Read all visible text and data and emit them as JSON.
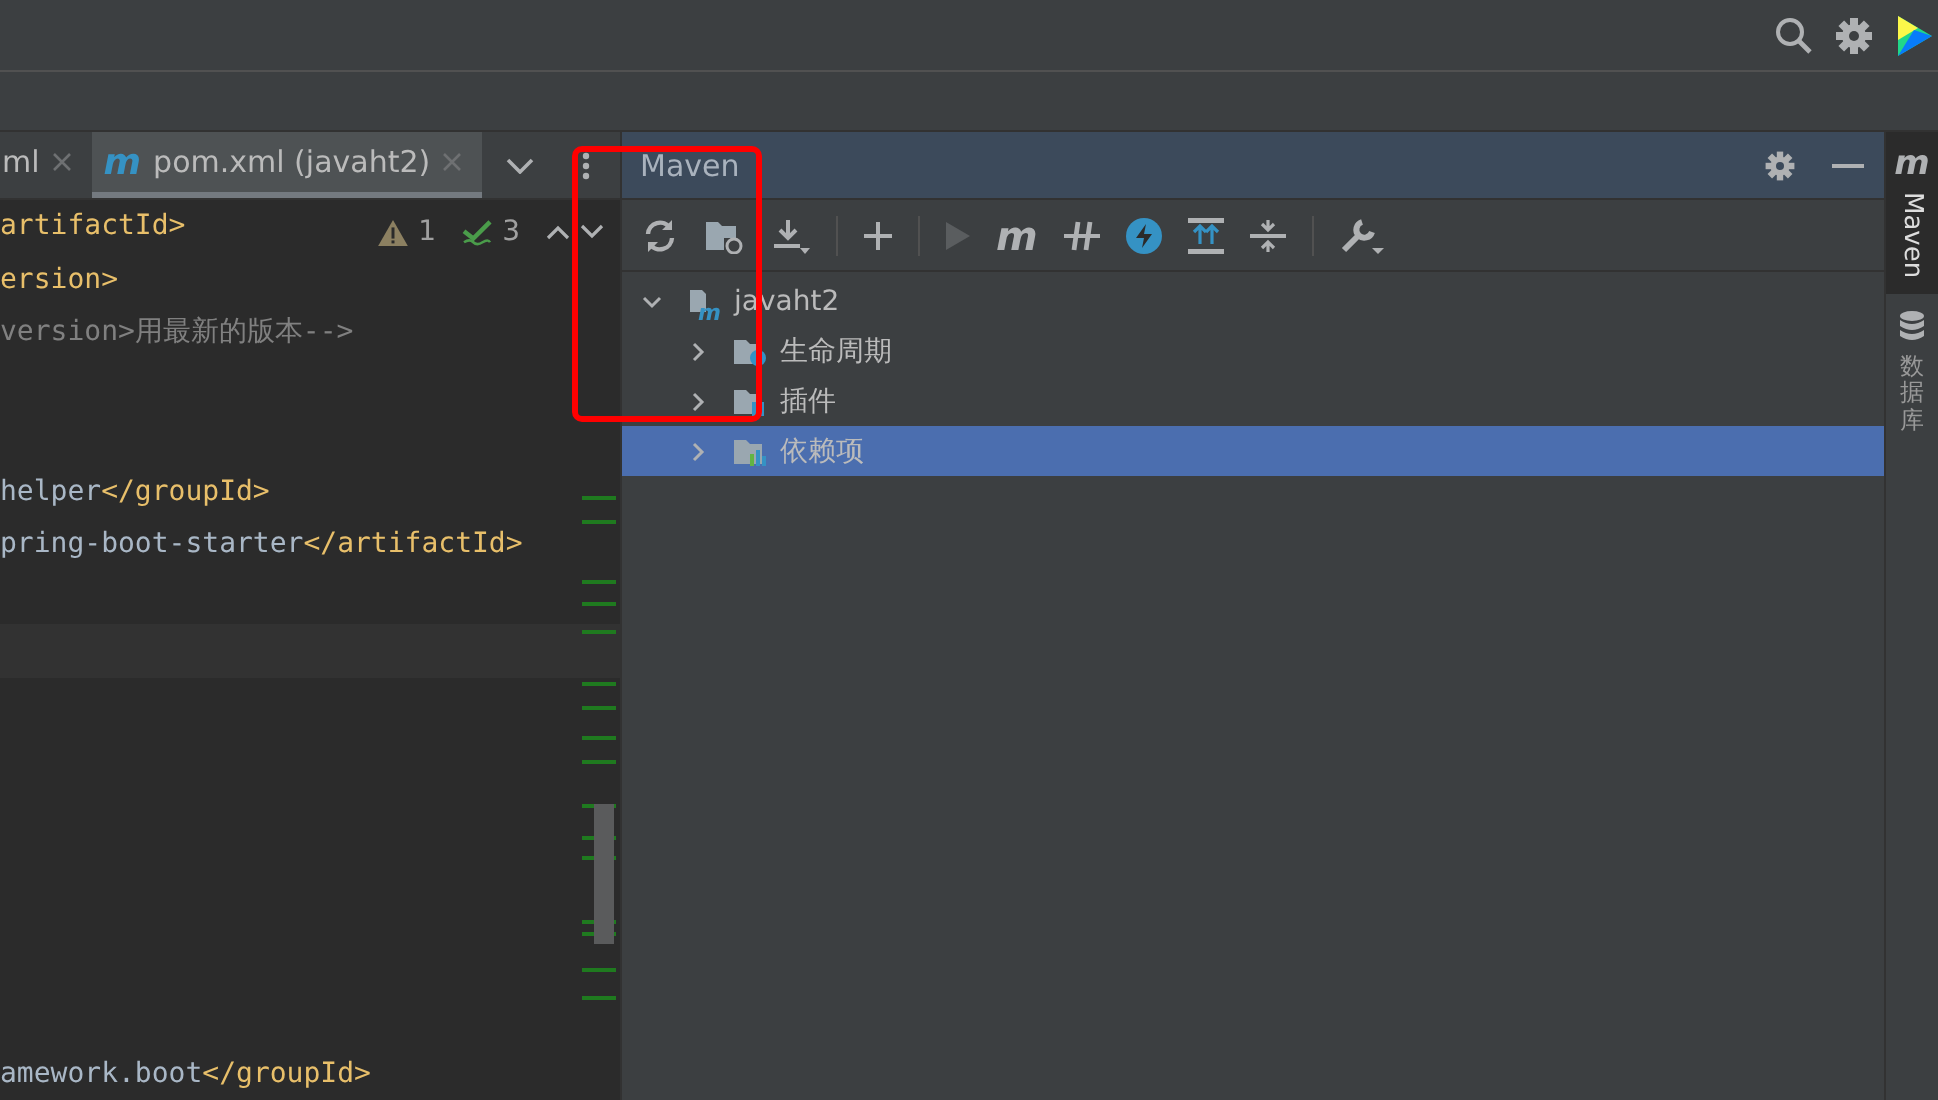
{
  "editor": {
    "tabs": [
      {
        "label": "ml",
        "selected": false,
        "kind": "file"
      },
      {
        "label": "pom.xml (javaht2)",
        "selected": true,
        "kind": "maven",
        "icon_text": "m"
      }
    ],
    "inspections": {
      "warnings": "1",
      "weak_warnings": "3"
    },
    "lines": [
      {
        "current": false,
        "parts": [
          {
            "kind": "tag",
            "text": "artifactId>"
          }
        ]
      },
      {
        "current": false,
        "parts": [
          {
            "kind": "tag",
            "text": "ersion>"
          }
        ]
      },
      {
        "current": false,
        "parts": [
          {
            "kind": "comment",
            "text": "version>用最新的版本-->"
          }
        ]
      },
      {
        "current": false
      },
      {
        "current": false
      },
      {
        "current": false,
        "parts": [
          {
            "kind": "text",
            "text": "helper"
          },
          {
            "kind": "tag",
            "text": "</groupId>"
          }
        ]
      },
      {
        "current": false,
        "parts": [
          {
            "kind": "text",
            "text": "pring-boot-starter"
          },
          {
            "kind": "tag",
            "text": "</artifactId>"
          }
        ]
      },
      {
        "current": false
      },
      {
        "current": true
      },
      {
        "current": false
      },
      {
        "current": false
      },
      {
        "current": false
      },
      {
        "current": false
      },
      {
        "current": false
      },
      {
        "current": false
      },
      {
        "current": false
      },
      {
        "current": false,
        "parts": [
          {
            "kind": "text",
            "text": "amework.boot"
          },
          {
            "kind": "tag",
            "text": "</groupId>"
          }
        ]
      }
    ]
  },
  "maven": {
    "title": "Maven",
    "toolbar_goal_text": "m",
    "tree": [
      {
        "label": "javaht2",
        "kind": "project",
        "icon_text": "m",
        "expanded": true,
        "selected": false,
        "children": [
          {
            "label": "生命周期",
            "kind": "lifecycle",
            "expanded": false,
            "selected": false
          },
          {
            "label": "插件",
            "kind": "plugins",
            "expanded": false,
            "selected": false
          },
          {
            "label": "依赖项",
            "kind": "dependencies",
            "expanded": false,
            "selected": true
          }
        ]
      }
    ]
  },
  "side_tabs": [
    {
      "label": "Maven",
      "selected": true,
      "kind": "maven",
      "icon_text": "m"
    },
    {
      "label": "数据库",
      "selected": false,
      "kind": "database"
    }
  ],
  "annotations": [
    {
      "kind": "rectangle",
      "color": "#ff0000"
    }
  ]
}
